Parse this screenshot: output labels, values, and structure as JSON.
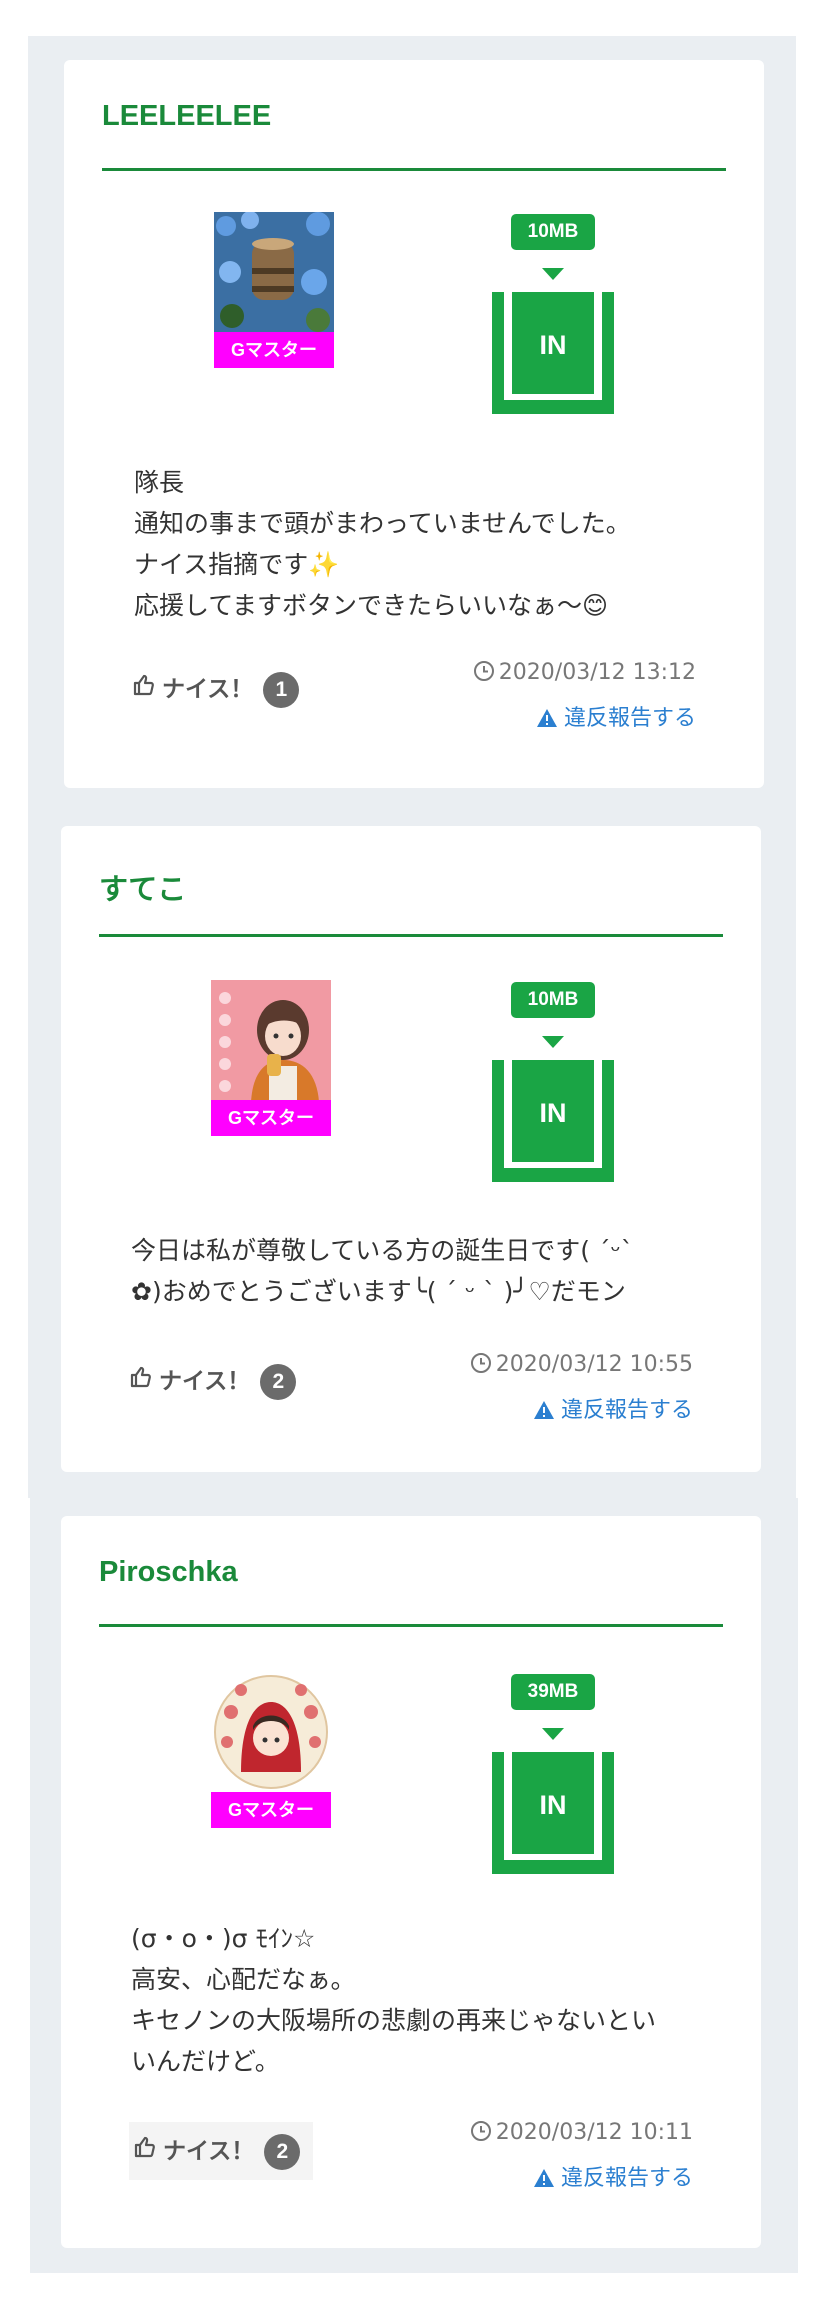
{
  "posts": [
    {
      "username": "LEELEELEE",
      "badge": "Gマスター",
      "size": "10MB",
      "status": "IN",
      "message": [
        "隊長",
        "通知の事まで頭がまわっていませんでした。",
        "ナイス指摘です✨",
        "応援してますボタンできたらいいなぁ〜😊"
      ],
      "nice_label": "ナイス！",
      "nice_count": "1",
      "date": "2020/03/12 13:12",
      "report": "違反報告する"
    },
    {
      "username": "すてこ",
      "badge": "Gマスター",
      "size": "10MB",
      "status": "IN",
      "message": [
        "今日は私が尊敬している方の誕生日です(  ˊᵕˋ",
        "✿)おめでとうございます╰( ´ ᵕ ` )╯♡だモン"
      ],
      "nice_label": "ナイス！",
      "nice_count": "2",
      "date": "2020/03/12 10:55",
      "report": "違反報告する"
    },
    {
      "username": "Piroschka",
      "badge": "Gマスター",
      "size": "39MB",
      "status": "IN",
      "message": [
        "(σ・o・)σ ﾓｲﾝ☆",
        "高安、心配だなぁ。",
        "キセノンの大阪場所の悲劇の再来じゃないとい",
        "いんだけど。"
      ],
      "nice_label": "ナイス！",
      "nice_count": "2",
      "date": "2020/03/12 10:11",
      "report": "違反報告する"
    }
  ],
  "colors": {
    "accent": "#1a8a3a",
    "status_green": "#1aa545",
    "badge_magenta": "#ff00ff",
    "link": "#2b7fd0"
  },
  "icons": [
    "thumbs-up-icon",
    "clock-icon",
    "warning-icon"
  ]
}
